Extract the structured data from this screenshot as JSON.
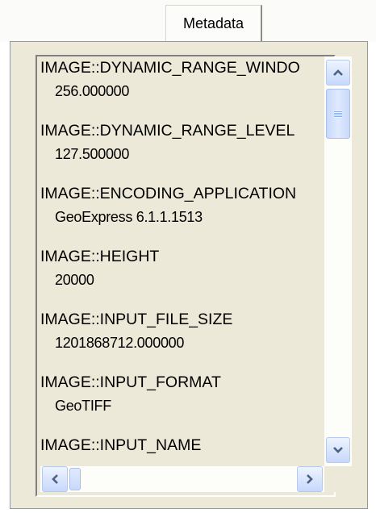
{
  "tab": {
    "label": "Metadata"
  },
  "metadata_entries": [
    {
      "key": "IMAGE::DYNAMIC_RANGE_WINDO",
      "value": "256.000000"
    },
    {
      "key": "IMAGE::DYNAMIC_RANGE_LEVEL",
      "value": "127.500000"
    },
    {
      "key": "IMAGE::ENCODING_APPLICATION",
      "value": "GeoExpress 6.1.1.1513"
    },
    {
      "key": "IMAGE::HEIGHT",
      "value": "20000"
    },
    {
      "key": "IMAGE::INPUT_FILE_SIZE",
      "value": "1201868712.000000"
    },
    {
      "key": "IMAGE::INPUT_FORMAT",
      "value": "GeoTIFF"
    },
    {
      "key": "IMAGE::INPUT_NAME",
      "value": ""
    }
  ],
  "icons": {
    "scroll_up": "chevron-up-icon",
    "scroll_down": "chevron-down-icon",
    "scroll_left": "chevron-left-icon",
    "scroll_right": "chevron-right-icon"
  },
  "colors": {
    "panel_bg": "#ece9d8",
    "scroll_button": "#c6d8fc",
    "arrow": "#4d6185"
  }
}
